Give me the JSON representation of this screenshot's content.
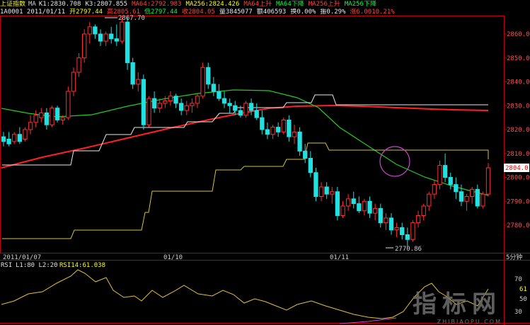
{
  "header": {
    "title": "上证指数",
    "ma_tag": "MA",
    "items": [
      {
        "text": "K1:2830.708",
        "color": "w"
      },
      {
        "text": "K3:2807.855",
        "color": "w"
      },
      {
        "text": "MA64:2792.983",
        "color": "r"
      },
      {
        "text": "MA256:2824.426",
        "color": "y"
      },
      {
        "text": "MA64上升",
        "color": "r"
      },
      {
        "text": "MA64下降",
        "color": "g"
      },
      {
        "text": "MA256上升",
        "color": "r"
      },
      {
        "text": "MA256下降",
        "color": "g"
      }
    ],
    "row2": [
      {
        "text": "1A0001 2011/01/11",
        "color": "w"
      },
      {
        "text": "开2797.44",
        "color": "y"
      },
      {
        "text": "高2805.61",
        "color": "r"
      },
      {
        "text": "低2797.44",
        "color": "g"
      },
      {
        "text": "收2804.05",
        "color": "r"
      },
      {
        "text": "量3845077",
        "color": "w"
      },
      {
        "text": "额406593",
        "color": "w"
      },
      {
        "text": "换0.00%",
        "color": "w"
      },
      {
        "text": "振0.29%",
        "color": "w"
      },
      {
        "text": "涨6.0010.21%",
        "color": "r"
      }
    ]
  },
  "price_axis": {
    "ticks": [
      "2860.0",
      "2850.0",
      "2840.0",
      "2830.0",
      "2820.0",
      "2810.0",
      "2800.0",
      "2790.0",
      "2780.0"
    ],
    "current": "2804.0"
  },
  "annotations": {
    "high": "2867.70",
    "low": "2770.86"
  },
  "date_axis": {
    "labels": [
      "2011/01/07",
      "01/10",
      "01/11"
    ],
    "period": "5分钟"
  },
  "rsi": {
    "title": "RSI",
    "params": "L1:80 L2:20",
    "value": "RSI14:61.038",
    "ticks": [
      "70",
      "61",
      "50",
      "30"
    ]
  },
  "watermark": {
    "cn": "指标网",
    "en": "ZHIBIAOPU.COM"
  },
  "chart_data": {
    "type": "candlestick",
    "ylim": [
      2770,
      2870
    ],
    "candles": [
      [
        2817,
        2819,
        2813,
        2815
      ],
      [
        2816,
        2819,
        2813,
        2814
      ],
      [
        2815,
        2819,
        2814,
        2818
      ],
      [
        2818,
        2821,
        2814,
        2815
      ],
      [
        2816,
        2821,
        2815,
        2820
      ],
      [
        2820,
        2826,
        2818,
        2823
      ],
      [
        2823,
        2828,
        2821,
        2826
      ],
      [
        2825,
        2829,
        2823,
        2827
      ],
      [
        2827,
        2829,
        2820,
        2822
      ],
      [
        2822,
        2830,
        2821,
        2829
      ],
      [
        2829,
        2830,
        2823,
        2824
      ],
      [
        2824,
        2826,
        2822,
        2825
      ],
      [
        2825,
        2838,
        2824,
        2836
      ],
      [
        2836,
        2846,
        2834,
        2844
      ],
      [
        2844,
        2852,
        2842,
        2850
      ],
      [
        2850,
        2862,
        2848,
        2860
      ],
      [
        2860,
        2865,
        2856,
        2863
      ],
      [
        2863,
        2864,
        2858,
        2860
      ],
      [
        2860,
        2862,
        2855,
        2857
      ],
      [
        2857,
        2861,
        2855,
        2860
      ],
      [
        2860,
        2863,
        2856,
        2858
      ],
      [
        2858,
        2864,
        2855,
        2857
      ],
      [
        2857,
        2867,
        2856,
        2865
      ],
      [
        2865,
        2867,
        2845,
        2848
      ],
      [
        2848,
        2850,
        2837,
        2839
      ],
      [
        2839,
        2844,
        2836,
        2841
      ],
      [
        2841,
        2843,
        2820,
        2822
      ],
      [
        2822,
        2834,
        2821,
        2833
      ],
      [
        2833,
        2836,
        2827,
        2829
      ],
      [
        2829,
        2833,
        2827,
        2831
      ],
      [
        2831,
        2834,
        2829,
        2832
      ],
      [
        2832,
        2836,
        2830,
        2834
      ],
      [
        2834,
        2835,
        2829,
        2831
      ],
      [
        2831,
        2833,
        2826,
        2828
      ],
      [
        2828,
        2832,
        2826,
        2830
      ],
      [
        2830,
        2833,
        2827,
        2831
      ],
      [
        2831,
        2835,
        2829,
        2834
      ],
      [
        2834,
        2848,
        2833,
        2846
      ],
      [
        2846,
        2848,
        2837,
        2839
      ],
      [
        2839,
        2842,
        2834,
        2836
      ],
      [
        2836,
        2839,
        2832,
        2833
      ],
      [
        2833,
        2836,
        2829,
        2831
      ],
      [
        2831,
        2833,
        2827,
        2830
      ],
      [
        2830,
        2832,
        2826,
        2828
      ],
      [
        2828,
        2830,
        2825,
        2826
      ],
      [
        2826,
        2832,
        2825,
        2831
      ],
      [
        2831,
        2833,
        2826,
        2828
      ],
      [
        2828,
        2831,
        2824,
        2825
      ],
      [
        2825,
        2828,
        2818,
        2820
      ],
      [
        2820,
        2823,
        2816,
        2818
      ],
      [
        2818,
        2822,
        2816,
        2821
      ],
      [
        2821,
        2823,
        2817,
        2819
      ],
      [
        2819,
        2825,
        2818,
        2824
      ],
      [
        2824,
        2826,
        2815,
        2817
      ],
      [
        2817,
        2822,
        2814,
        2819
      ],
      [
        2819,
        2821,
        2809,
        2811
      ],
      [
        2811,
        2814,
        2806,
        2808
      ],
      [
        2808,
        2811,
        2800,
        2802
      ],
      [
        2802,
        2804,
        2790,
        2792
      ],
      [
        2792,
        2798,
        2790,
        2796
      ],
      [
        2796,
        2798,
        2791,
        2793
      ],
      [
        2793,
        2796,
        2789,
        2794
      ],
      [
        2794,
        2796,
        2782,
        2784
      ],
      [
        2784,
        2790,
        2783,
        2788
      ],
      [
        2788,
        2793,
        2786,
        2791
      ],
      [
        2791,
        2794,
        2787,
        2789
      ],
      [
        2789,
        2792,
        2785,
        2786
      ],
      [
        2786,
        2791,
        2784,
        2790
      ],
      [
        2790,
        2792,
        2783,
        2785
      ],
      [
        2785,
        2789,
        2782,
        2787
      ],
      [
        2787,
        2789,
        2779,
        2781
      ],
      [
        2781,
        2785,
        2778,
        2783
      ],
      [
        2783,
        2785,
        2776,
        2778
      ],
      [
        2778,
        2781,
        2775,
        2779
      ],
      [
        2779,
        2781,
        2774,
        2776
      ],
      [
        2776,
        2779,
        2771,
        2774
      ],
      [
        2774,
        2782,
        2773,
        2781
      ],
      [
        2781,
        2786,
        2779,
        2784
      ],
      [
        2784,
        2789,
        2782,
        2788
      ],
      [
        2788,
        2794,
        2786,
        2793
      ],
      [
        2793,
        2799,
        2791,
        2797
      ],
      [
        2797,
        2807,
        2795,
        2805
      ],
      [
        2805,
        2810,
        2798,
        2800
      ],
      [
        2800,
        2802,
        2795,
        2797
      ],
      [
        2797,
        2800,
        2791,
        2794
      ],
      [
        2794,
        2797,
        2788,
        2790
      ],
      [
        2790,
        2793,
        2786,
        2792
      ],
      [
        2792,
        2796,
        2789,
        2795
      ],
      [
        2795,
        2797,
        2787,
        2788
      ],
      [
        2788,
        2794,
        2787,
        2793
      ],
      [
        2793,
        2806,
        2792,
        2804
      ]
    ]
  }
}
